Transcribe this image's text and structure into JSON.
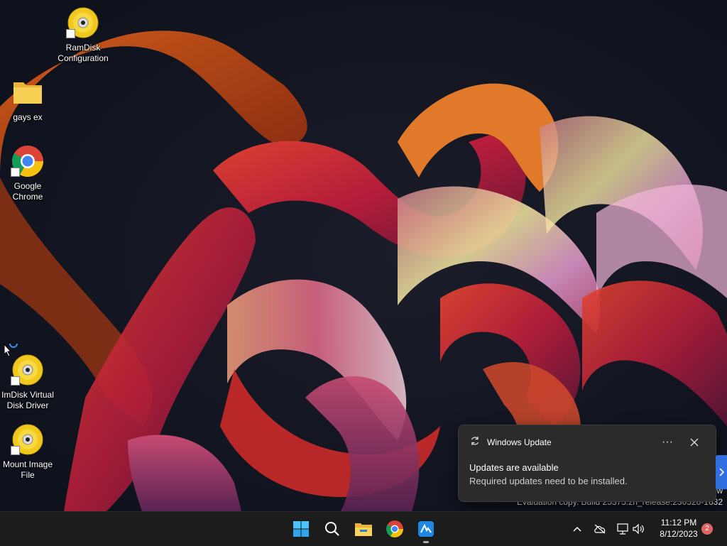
{
  "desktop": {
    "icons": [
      {
        "label": "RamDisk\nConfiguration",
        "icon": "cd-disc-icon"
      },
      {
        "label": "gays ex",
        "icon": "folder-icon"
      },
      {
        "label": "Google\nChrome",
        "icon": "chrome-icon"
      },
      {
        "label": "ImDisk Virtual\nDisk Driver",
        "icon": "cd-disc-icon"
      },
      {
        "label": "Mount Image\nFile",
        "icon": "cd-disc-icon"
      }
    ],
    "watermark_line1": "ew",
    "watermark_line2": "Evaluation copy. Build 25375.zn_release.230520-1632"
  },
  "toast": {
    "app_name": "Windows Update",
    "title": "Updates are available",
    "body": "Required updates need to be installed.",
    "more_label": "···",
    "accent": "#2f6fe0"
  },
  "taskbar": {
    "apps": [
      "start-button",
      "search-button",
      "file-explorer",
      "google-chrome",
      "quick-assist"
    ],
    "time": "11:12 PM",
    "date": "8/12/2023",
    "notification_count": "2"
  }
}
